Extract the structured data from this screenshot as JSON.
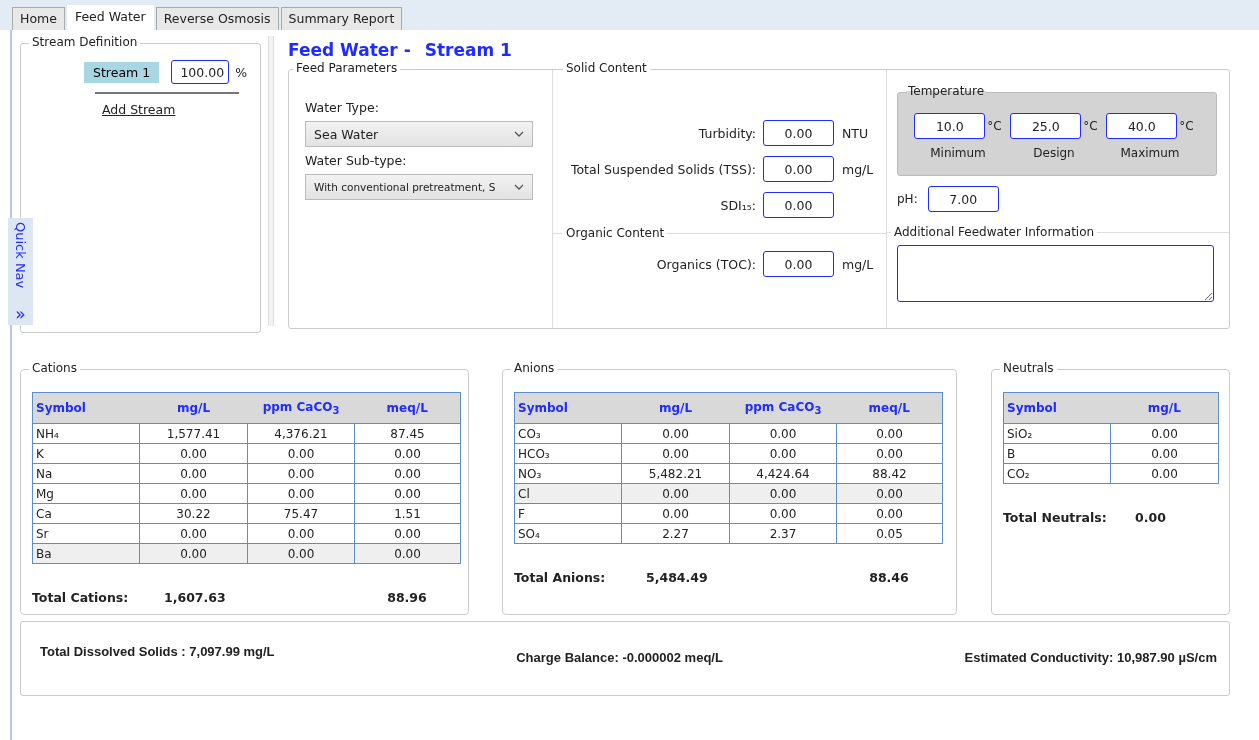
{
  "tabs": [
    {
      "label": "Home",
      "selected": false
    },
    {
      "label": "Feed Water",
      "selected": true
    },
    {
      "label": "Reverse Osmosis",
      "selected": false
    },
    {
      "label": "Summary Report",
      "selected": false
    }
  ],
  "stream_definition": {
    "title": "Stream Definition",
    "streams": [
      {
        "name": "Stream 1",
        "value": "100.00",
        "unit": "%",
        "selected": true
      }
    ],
    "add_link": "Add Stream"
  },
  "quick_nav": {
    "label": "Quick Nav",
    "icon": "»"
  },
  "page_title": {
    "prefix": "Feed Water -",
    "stream": "Stream 1"
  },
  "feed_parameters": {
    "title": "Feed Parameters",
    "water_type": {
      "label": "Water Type:",
      "value": "Sea Water"
    },
    "water_subtype": {
      "label": "Water Sub-type:",
      "value": "With conventional pretreatment, S"
    }
  },
  "solid_content": {
    "title": "Solid Content",
    "fields": [
      {
        "label": "Turbidity:",
        "value": "0.00",
        "unit": "NTU"
      },
      {
        "label": "Total Suspended Solids (TSS):",
        "value": "0.00",
        "unit": "mg/L"
      },
      {
        "label": "SDI₁₅:",
        "value": "0.00"
      }
    ]
  },
  "organic_content": {
    "title": "Organic Content",
    "fields": [
      {
        "label": "Organics (TOC):",
        "value": "0.00",
        "unit": "mg/L"
      }
    ]
  },
  "temperature": {
    "title": "Temperature",
    "fields": [
      {
        "value": "10.0",
        "unit": "°C",
        "caption": "Minimum"
      },
      {
        "value": "25.0",
        "unit": "°C",
        "caption": "Design"
      },
      {
        "value": "40.0",
        "unit": "°C",
        "caption": "Maximum"
      }
    ]
  },
  "ph": {
    "label": "pH:",
    "value": "7.00"
  },
  "additional_info": {
    "title": "Additional Feedwater Information"
  },
  "ion_tables": [
    {
      "title": "Cations",
      "columns": [
        "Symbol",
        "mg/L",
        "ppm CaCO$_{3}$",
        "meq/L"
      ],
      "rows": [
        {
          "cells": [
            "NH₄",
            "1,577.41",
            "4,376.21",
            "87.45"
          ],
          "selected": false
        },
        {
          "cells": [
            "K",
            "0.00",
            "0.00",
            "0.00"
          ],
          "selected": false
        },
        {
          "cells": [
            "Na",
            "0.00",
            "0.00",
            "0.00"
          ],
          "selected": false
        },
        {
          "cells": [
            "Mg",
            "0.00",
            "0.00",
            "0.00"
          ],
          "selected": false
        },
        {
          "cells": [
            "Ca",
            "30.22",
            "75.47",
            "1.51"
          ],
          "selected": false
        },
        {
          "cells": [
            "Sr",
            "0.00",
            "0.00",
            "0.00"
          ],
          "selected": false
        },
        {
          "cells": [
            "Ba",
            "0.00",
            "0.00",
            "0.00"
          ],
          "selected": true
        }
      ],
      "total": {
        "label": "Total Cations:",
        "mg_l": "1,607.63",
        "meq_l": "88.96"
      }
    },
    {
      "title": "Anions",
      "columns": [
        "Symbol",
        "mg/L",
        "ppm CaCO$_{3}$",
        "meq/L"
      ],
      "rows": [
        {
          "cells": [
            "CO₃",
            "0.00",
            "0.00",
            "0.00"
          ],
          "selected": false
        },
        {
          "cells": [
            "HCO₃",
            "0.00",
            "0.00",
            "0.00"
          ],
          "selected": false
        },
        {
          "cells": [
            "NO₃",
            "5,482.21",
            "4,424.64",
            "88.42"
          ],
          "selected": false
        },
        {
          "cells": [
            "Cl",
            "0.00",
            "0.00",
            "0.00"
          ],
          "selected": true
        },
        {
          "cells": [
            "F",
            "0.00",
            "0.00",
            "0.00"
          ],
          "selected": false
        },
        {
          "cells": [
            "SO₄",
            "2.27",
            "2.37",
            "0.05"
          ],
          "selected": false
        }
      ],
      "total": {
        "label": "Total Anions:",
        "mg_l": "5,484.49",
        "meq_l": "88.46"
      }
    },
    {
      "title": "Neutrals",
      "columns": [
        "Symbol",
        "mg/L"
      ],
      "rows": [
        {
          "cells": [
            "SiO₂",
            "0.00"
          ],
          "selected": false
        },
        {
          "cells": [
            "B",
            "0.00"
          ],
          "selected": false
        },
        {
          "cells": [
            "CO₂",
            "0.00"
          ],
          "selected": false
        }
      ],
      "total": {
        "label": "Total Neutrals:",
        "mg_l": "0.00"
      }
    }
  ],
  "summary": {
    "total_dissolved_solids": "Total Dissolved Solids : 7,097.99 mg/L",
    "charge_balance": "Charge Balance: -0.000002 meq/L",
    "conductivity": "Estimated Conductivity: 10,987.90 µS/cm"
  }
}
